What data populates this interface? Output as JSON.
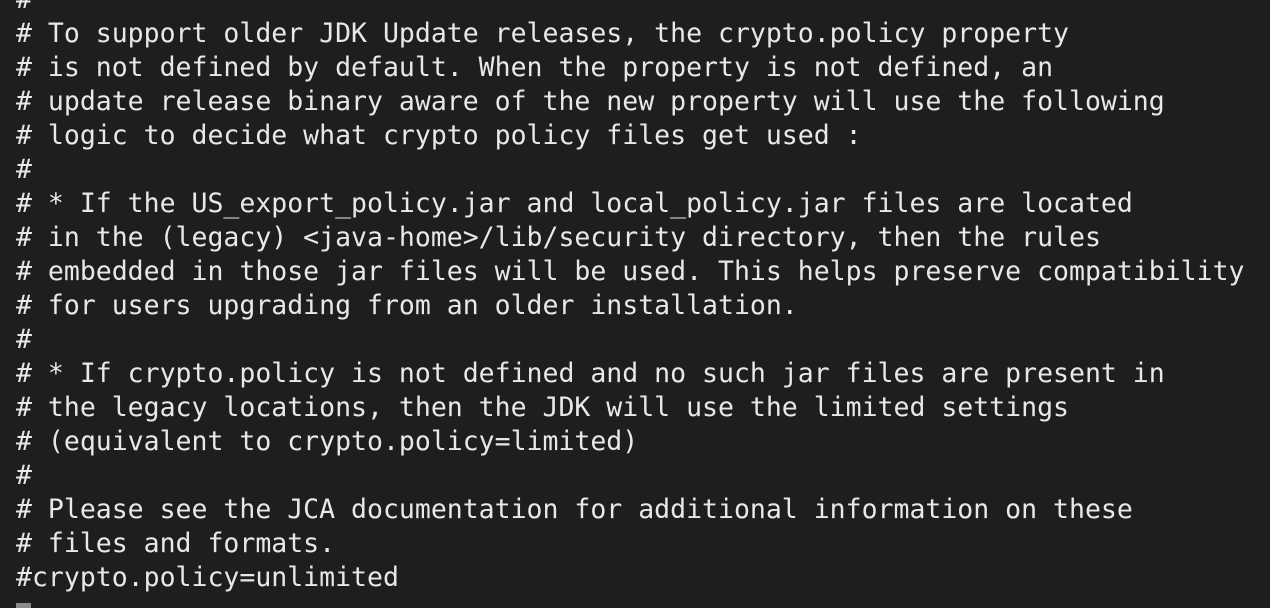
{
  "terminal": {
    "lines": [
      "#",
      "# To support older JDK Update releases, the crypto.policy property",
      "# is not defined by default. When the property is not defined, an",
      "# update release binary aware of the new property will use the following",
      "# logic to decide what crypto policy files get used :",
      "#",
      "# * If the US_export_policy.jar and local_policy.jar files are located",
      "# in the (legacy) <java-home>/lib/security directory, then the rules",
      "# embedded in those jar files will be used. This helps preserve compatibility",
      "# for users upgrading from an older installation.",
      "#",
      "# * If crypto.policy is not defined and no such jar files are present in",
      "# the legacy locations, then the JDK will use the limited settings",
      "# (equivalent to crypto.policy=limited)",
      "#",
      "# Please see the JCA documentation for additional information on these",
      "# files and formats.",
      "#crypto.policy=unlimited"
    ]
  }
}
